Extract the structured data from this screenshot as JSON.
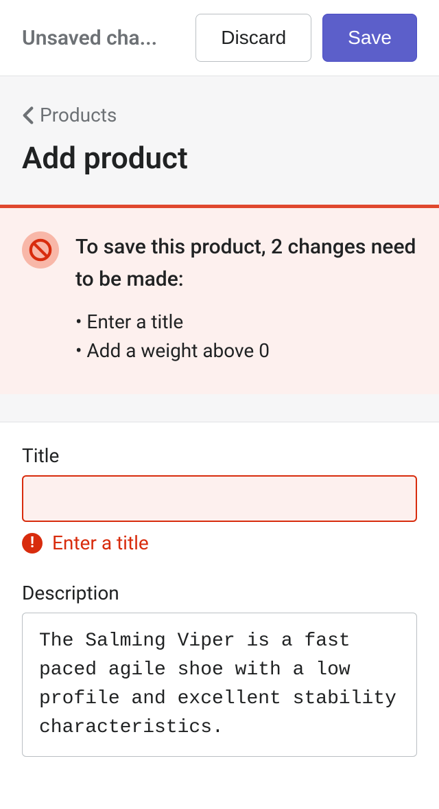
{
  "topbar": {
    "title": "Unsaved cha...",
    "discard_label": "Discard",
    "save_label": "Save"
  },
  "breadcrumb": {
    "label": "Products"
  },
  "page": {
    "title": "Add product"
  },
  "banner": {
    "heading": "To save this product, 2 changes need to be made:",
    "items": [
      "Enter a title",
      "Add a weight above 0"
    ]
  },
  "form": {
    "title": {
      "label": "Title",
      "value": "",
      "error": "Enter a title"
    },
    "description": {
      "label": "Description",
      "value": "The Salming Viper is a fast paced agile shoe with a low profile and excellent stability characteristics."
    }
  }
}
